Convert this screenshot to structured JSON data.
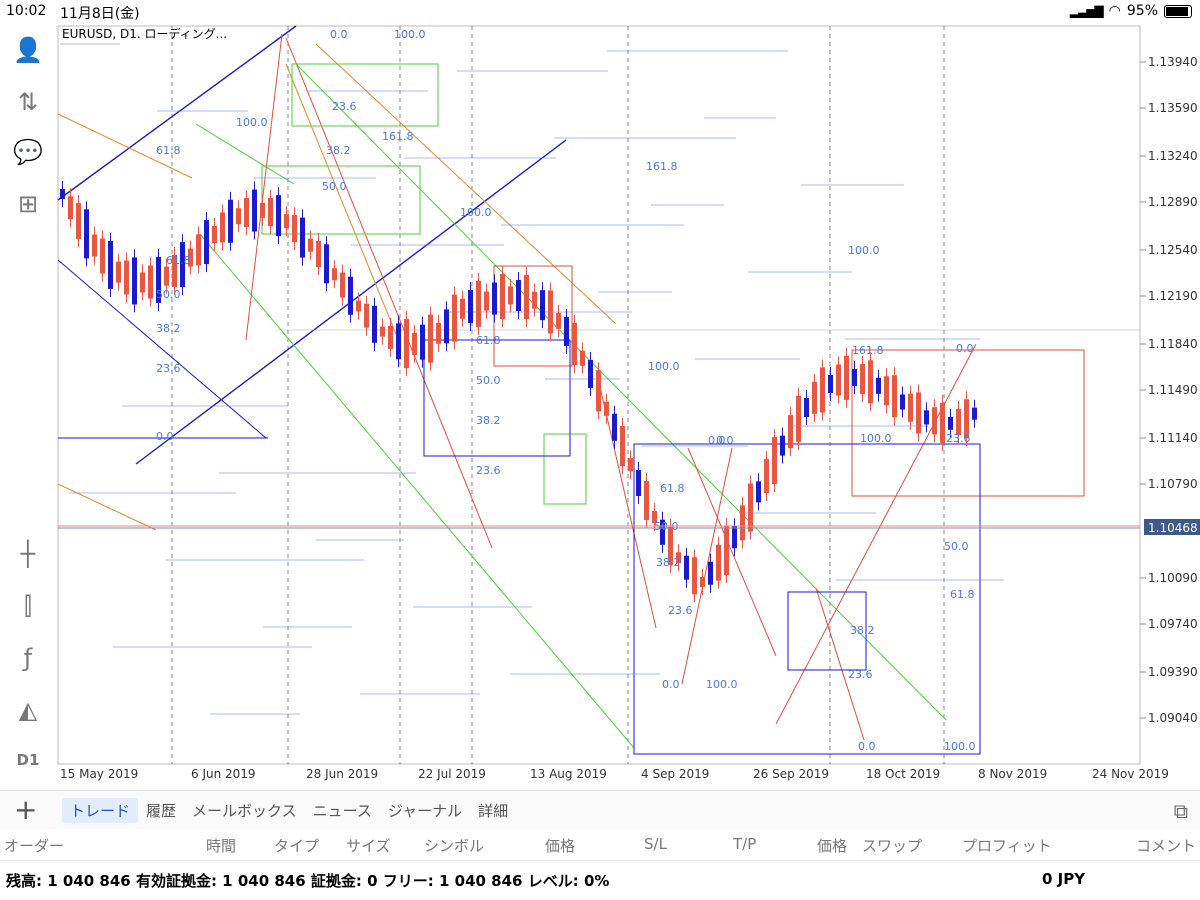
{
  "status_bar": {
    "time": "10:02",
    "date": "11月8日(金)",
    "battery": "95%"
  },
  "sidebar": [
    {
      "name": "account-icon",
      "glyph": "👤"
    },
    {
      "name": "trade-arrows-icon",
      "glyph": "⇅"
    },
    {
      "name": "chat-icon",
      "glyph": "💬"
    },
    {
      "name": "new-order-icon",
      "glyph": "⊞"
    },
    {
      "name": "crosshair-icon",
      "glyph": "┼"
    },
    {
      "name": "chart-type-icon",
      "glyph": "⫿"
    },
    {
      "name": "indicators-icon",
      "glyph": "ƒ"
    },
    {
      "name": "objects-icon",
      "glyph": "◭"
    },
    {
      "name": "timeframe-button",
      "glyph": "D1"
    }
  ],
  "chart": {
    "symbol_title": "EURUSD, D1. ローディング...",
    "current_price": "1.10468",
    "price_levels": [
      "1.13940",
      "1.13590",
      "1.13240",
      "1.12890",
      "1.12540",
      "1.12190",
      "1.11840",
      "1.11490",
      "1.11140",
      "1.10790",
      "1.10090",
      "1.09740",
      "1.09390",
      "1.09040"
    ],
    "date_labels": [
      "15 May 2019",
      "6 Jun 2019",
      "28 Jun 2019",
      "22 Jul 2019",
      "13 Aug 2019",
      "4 Sep 2019",
      "26 Sep 2019",
      "18 Oct 2019",
      "8 Nov 2019",
      "24 Nov 2019"
    ],
    "fib_labels": [
      "0.0",
      "100.0",
      "23.6",
      "161.8",
      "38.2",
      "50.0",
      "61.8",
      "100.0",
      "61.8",
      "50.0",
      "38.2",
      "23.6",
      "0.0",
      "100.0",
      "161.8",
      "100.0",
      "161.8",
      "100.0",
      "0.0",
      "61.8",
      "50.0",
      "38.2",
      "23.6",
      "0.0",
      "100.0",
      "0.0",
      "23.6",
      "100.0",
      "50.0",
      "61.8",
      "38.2",
      "23.6",
      "0.0",
      "100.0",
      "0.0",
      "23.6",
      "38.2",
      "50.0",
      "61.8"
    ],
    "colors": {
      "up": "#e8573f",
      "down": "#1a1acc",
      "bg": "#ffffff",
      "grid": "#d9d9d9",
      "fib": "#4a7adf"
    }
  },
  "toolbar": {
    "add_icon": "+",
    "tabs": [
      "トレード",
      "履歴",
      "メールボックス",
      "ニュース",
      "ジャーナル",
      "詳細"
    ],
    "active_tab": "トレード"
  },
  "columns": [
    "オーダー",
    "時間",
    "タイプ",
    "サイズ",
    "シンボル",
    "価格",
    "S/L",
    "T/P",
    "価格",
    "スワップ",
    "プロフィット",
    "コメント"
  ],
  "footer": {
    "summary": "残高: 1 040 846 有効証拠金: 1 040 846 証拠金: 0 フリー: 1 040 846 レベル: 0%",
    "profit": "0  JPY"
  }
}
